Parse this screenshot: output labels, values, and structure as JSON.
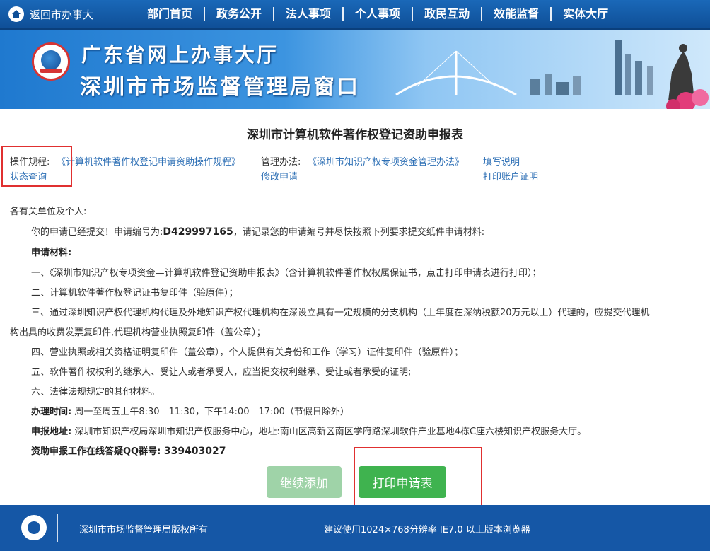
{
  "topbar": {
    "back_label": "返回市办事大",
    "nav": [
      "部门首页",
      "政务公开",
      "法人事项",
      "个人事项",
      "政民互动",
      "效能监督",
      "实体大厅"
    ]
  },
  "banner": {
    "title_line1": "广东省网上办事大厅",
    "title_line2": "深圳市市场监督管理局窗口"
  },
  "form_title": "深圳市计算机软件著作权登记资助申报表",
  "links": {
    "procedure_label": "操作规程:",
    "procedure_link": "《计算机软件著作权登记申请资助操作规程》",
    "method_label": "管理办法:",
    "method_link": "《深圳市知识产权专项资金管理办法》",
    "fill_instructions": "填写说明",
    "status_query": "状态查询",
    "modify_application": "修改申请",
    "print_account": "打印账户证明"
  },
  "content": {
    "greeting": "各有关单位及个人:",
    "submitted_prefix": "你的申请已经提交！申请编号为:",
    "application_no": "D429997165",
    "submitted_suffix": "，请记录您的申请编号并尽快按照下列要求提交纸件申请材料:",
    "materials_heading": "申请材料:",
    "item1": "一、《深圳市知识产权专项资金—计算机软件登记资助申报表》（含计算机软件著作权权属保证书，点击打印申请表进行打印）；",
    "item2": "二、计算机软件著作权登记证书复印件（验原件）；",
    "item3a": "三、通过深圳知识产权代理机构代理及外地知识产权代理机构在深设立具有一定规模的分支机构（上年度在深纳税额20万元以上）代理的，应提交代理机",
    "item3b": "构出具的收费发票复印件,代理机构营业执照复印件（盖公章）；",
    "item4": "四、营业执照或相关资格证明复印件（盖公章），个人提供有关身份和工作（学习）证件复印件（验原件）；",
    "item5": "五、软件著作权权利的继承人、受让人或者承受人，应当提交权利继承、受让或者承受的证明;",
    "item6": "六、法律法规规定的其他材料。",
    "hours_label": "办理时间:",
    "hours_value": "周一至周五上午8:30—11:30，下午14:00—17:00（节假日除外）",
    "address_label": "申报地址:",
    "address_value": "深圳市知识产权局深圳市知识产权服务中心，地址:南山区高新区南区学府路深圳软件产业基地4栋C座六楼知识产权服务大厅。",
    "qq_label": "资助申报工作在线答疑QQ群号:",
    "qq_value": "339403027"
  },
  "buttons": {
    "continue_label": "继续添加",
    "print_label": "打印申请表"
  },
  "footer": {
    "copyright": "深圳市市场监督管理局版权所有",
    "browser_tip": "建议使用1024×768分辨率 IE7.0 以上版本浏览器"
  }
}
